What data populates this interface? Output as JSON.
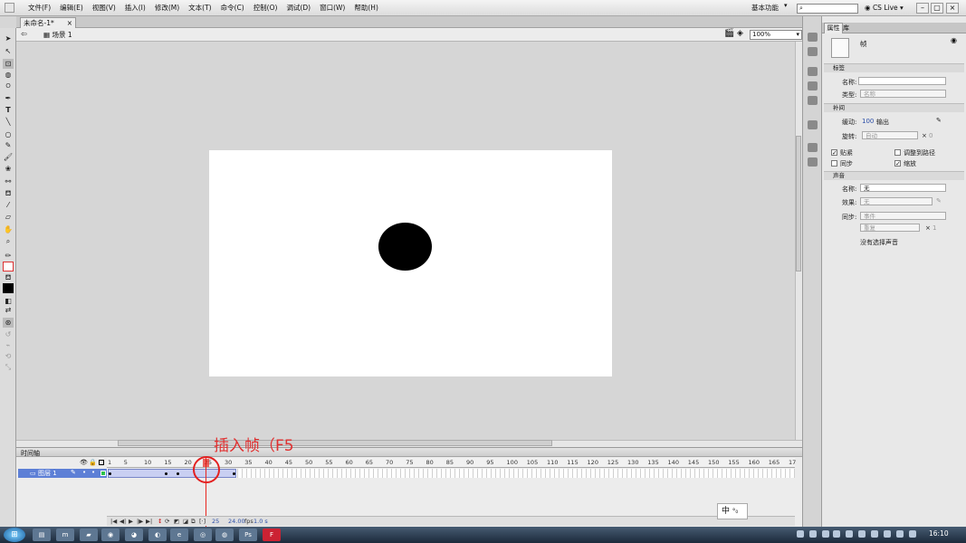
{
  "window": {
    "title_tab": "未命名-1*"
  },
  "menu": [
    "文件(F)",
    "编辑(E)",
    "视图(V)",
    "插入(I)",
    "修改(M)",
    "文本(T)",
    "命令(C)",
    "控制(O)",
    "调试(D)",
    "窗口(W)",
    "帮助(H)"
  ],
  "workspace": "基本功能",
  "cslive": "CS Live",
  "editbar": {
    "scene": "场景 1",
    "zoom": "100%"
  },
  "timeline": {
    "panel_title": "时间轴",
    "layer_name": "图层 1",
    "ruler_ticks": [
      "1",
      "5",
      "10",
      "15",
      "20",
      "25",
      "30",
      "35",
      "40",
      "45",
      "50",
      "55",
      "60",
      "65",
      "70",
      "75",
      "80",
      "85",
      "90",
      "95",
      "100",
      "105",
      "110",
      "115",
      "120",
      "125",
      "130",
      "135",
      "140",
      "145",
      "150",
      "155",
      "160",
      "165",
      "17"
    ],
    "current_frame": "25",
    "fps": "24.00",
    "fps_unit": "fps",
    "time": "1.0 s",
    "annotation": "插入帧（F5"
  },
  "ime": {
    "lang": "中",
    "mode": "°₀"
  },
  "properties": {
    "tab_props": "属性",
    "tab_lib": "库",
    "object_type": "帧",
    "section_label": "标签",
    "name_label": "名称:",
    "type_label": "类型:",
    "type_value": "名称",
    "section_tween": "补间",
    "ease_label": "缓动:",
    "ease_value": "100",
    "ease_suffix": "输出",
    "rotate_label": "旋转:",
    "rotate_value": "自动",
    "rotate_times": "0",
    "snap": "贴紧",
    "orient_path": "调整到路径",
    "sync": "同步",
    "scale": "缩放",
    "section_sound": "声音",
    "sound_name_label": "名称:",
    "sound_name_value": "无",
    "effect_label": "效果:",
    "effect_value": "无",
    "sync_label": "同步:",
    "sync_value": "事件",
    "repeat_value": "重复",
    "repeat_times": "1",
    "no_sound": "没有选择声音"
  },
  "taskbar": {
    "clock": "16:10"
  }
}
